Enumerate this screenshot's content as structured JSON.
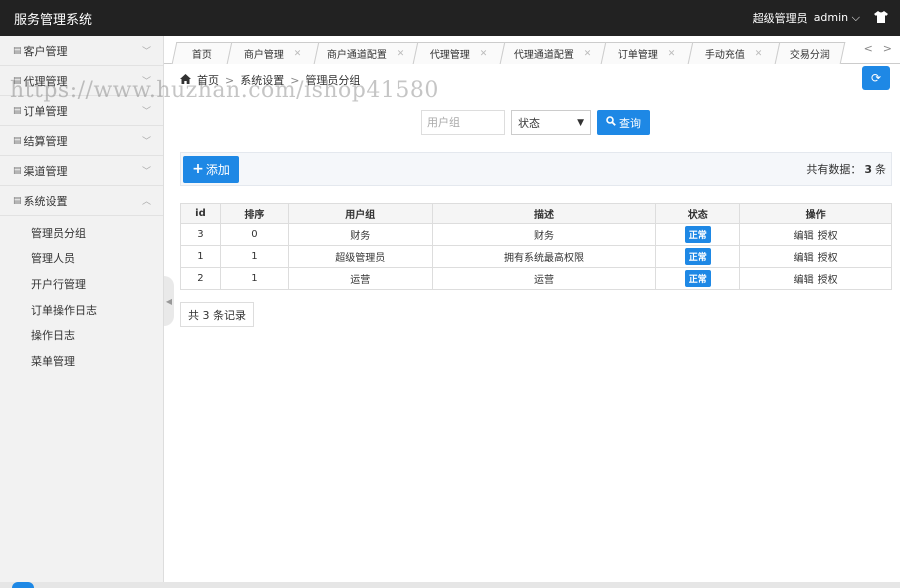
{
  "header": {
    "app_title": "服务管理系统",
    "user_role": "超级管理员",
    "user_name": "admin",
    "user_menu_icon": "chevron-down-icon",
    "skin_icon": "tshirt-icon"
  },
  "sidebar": {
    "menus": [
      {
        "label": "客户管理",
        "expanded": false
      },
      {
        "label": "代理管理",
        "expanded": false
      },
      {
        "label": "订单管理",
        "expanded": false
      },
      {
        "label": "结算管理",
        "expanded": false
      },
      {
        "label": "渠道管理",
        "expanded": false
      },
      {
        "label": "系统设置",
        "expanded": true
      }
    ],
    "submenu": [
      "管理员分组",
      "管理人员",
      "开户行管理",
      "订单操作日志",
      "操作日志",
      "菜单管理"
    ]
  },
  "tabs": [
    {
      "label": "首页",
      "closable": false
    },
    {
      "label": "商户管理",
      "closable": true
    },
    {
      "label": "商户通道配置",
      "closable": true
    },
    {
      "label": "代理管理",
      "closable": true
    },
    {
      "label": "代理通道配置",
      "closable": true
    },
    {
      "label": "订单管理",
      "closable": true
    },
    {
      "label": "手动充值",
      "closable": true
    },
    {
      "label": "交易分润",
      "closable": true
    }
  ],
  "tab_nav": {
    "prev": "<",
    "next": ">"
  },
  "breadcrumb": {
    "home": "首页",
    "section": "系统设置",
    "current": "管理员分组",
    "separator": ">"
  },
  "watermark": "https://www.huzhan.com/ishop41580",
  "search": {
    "usergroup_placeholder": "用户组",
    "status_label": "状态",
    "query_label": "查询"
  },
  "toolbar": {
    "add_label": "添加",
    "total_prefix": "共有数据：",
    "total_count": "3",
    "total_suffix": "条"
  },
  "table": {
    "columns": [
      "id",
      "排序",
      "用户组",
      "描述",
      "状态",
      "操作"
    ],
    "rows": [
      {
        "id": "3",
        "sort": "0",
        "group": "财务",
        "desc": "财务",
        "status": "正常",
        "edit": "编辑",
        "auth": "授权"
      },
      {
        "id": "1",
        "sort": "1",
        "group": "超级管理员",
        "desc": "拥有系统最高权限",
        "status": "正常",
        "edit": "编辑",
        "auth": "授权"
      },
      {
        "id": "2",
        "sort": "1",
        "group": "运营",
        "desc": "运营",
        "status": "正常",
        "edit": "编辑",
        "auth": "授权"
      }
    ]
  },
  "pagination": {
    "record_text": "共 3 条记录"
  },
  "colors": {
    "accent": "#1e88e5",
    "header_bg": "#222222",
    "sidebar_bg": "#f2f2f2"
  }
}
